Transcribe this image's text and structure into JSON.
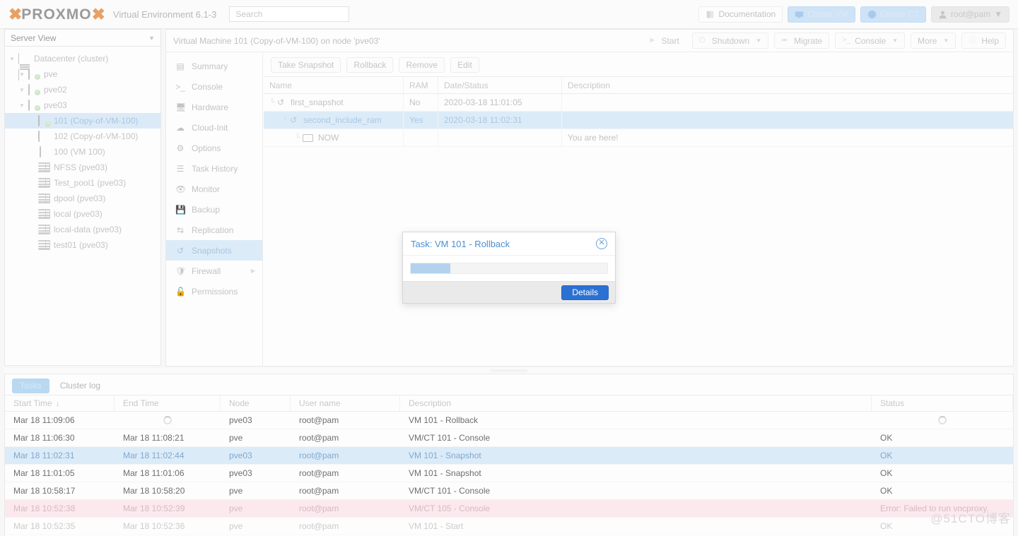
{
  "topbar": {
    "logo_text": "PROXMO",
    "env_label": "Virtual Environment 6.1-3",
    "search_placeholder": "Search",
    "buttons": [
      {
        "label": "Documentation",
        "icon": "book-icon"
      },
      {
        "label": "Create VM",
        "icon": "monitor-icon"
      },
      {
        "label": "Create CT",
        "icon": "container-icon"
      },
      {
        "label": "root@pam",
        "icon": "user-icon"
      }
    ]
  },
  "sidebar": {
    "view_label": "Server View",
    "items": [
      {
        "label": "Datacenter (cluster)",
        "icon": "datacenter-icon",
        "depth": 0,
        "selected": false
      },
      {
        "label": "pve",
        "icon": "node-icon",
        "depth": 1,
        "selected": false
      },
      {
        "label": "pve02",
        "icon": "node-icon",
        "depth": 1,
        "selected": false
      },
      {
        "label": "pve03",
        "icon": "node-icon",
        "depth": 1,
        "selected": false
      },
      {
        "label": "101 (Copy-of-VM-100)",
        "icon": "vm-running-icon",
        "depth": 2,
        "selected": true
      },
      {
        "label": "102 (Copy-of-VM-100)",
        "icon": "vm-stopped-icon",
        "depth": 2,
        "selected": false
      },
      {
        "label": "100 (VM 100)",
        "icon": "vm-template-icon",
        "depth": 2,
        "selected": false
      },
      {
        "label": "NFSS (pve03)",
        "icon": "storage-icon",
        "depth": 2,
        "selected": false
      },
      {
        "label": "Test_pool1 (pve03)",
        "icon": "storage-icon",
        "depth": 2,
        "selected": false
      },
      {
        "label": "dpool (pve03)",
        "icon": "storage-icon",
        "depth": 2,
        "selected": false
      },
      {
        "label": "local (pve03)",
        "icon": "storage-icon",
        "depth": 2,
        "selected": false
      },
      {
        "label": "local-data (pve03)",
        "icon": "storage-icon",
        "depth": 2,
        "selected": false
      },
      {
        "label": "test01 (pve03)",
        "icon": "storage-icon",
        "depth": 2,
        "selected": false
      }
    ]
  },
  "content_header": {
    "title": "Virtual Machine 101 (Copy-of-VM-100) on node 'pve03'",
    "buttons": [
      {
        "label": "Start",
        "icon": "play-icon",
        "has_arrow": false
      },
      {
        "label": "Shutdown",
        "icon": "power-icon",
        "has_arrow": true
      },
      {
        "label": "Migrate",
        "icon": "migrate-icon",
        "has_arrow": false
      },
      {
        "label": "Console",
        "icon": "terminal-icon",
        "has_arrow": true
      },
      {
        "label": "More",
        "icon": "",
        "has_arrow": true
      },
      {
        "label": "Help",
        "icon": "help-icon",
        "has_arrow": false
      }
    ]
  },
  "nav_menu": {
    "items": [
      {
        "label": "Summary",
        "icon": "summary-icon",
        "selected": false,
        "arrow": false
      },
      {
        "label": "Console",
        "icon": "terminal-icon",
        "selected": false,
        "arrow": false
      },
      {
        "label": "Hardware",
        "icon": "monitor-icon",
        "selected": false,
        "arrow": false
      },
      {
        "label": "Cloud-Init",
        "icon": "cloud-icon",
        "selected": false,
        "arrow": false
      },
      {
        "label": "Options",
        "icon": "gear-icon",
        "selected": false,
        "arrow": false
      },
      {
        "label": "Task History",
        "icon": "list-icon",
        "selected": false,
        "arrow": false
      },
      {
        "label": "Monitor",
        "icon": "eye-icon",
        "selected": false,
        "arrow": false
      },
      {
        "label": "Backup",
        "icon": "save-icon",
        "selected": false,
        "arrow": false
      },
      {
        "label": "Replication",
        "icon": "replication-icon",
        "selected": false,
        "arrow": false
      },
      {
        "label": "Snapshots",
        "icon": "rollback-icon",
        "selected": true,
        "arrow": false
      },
      {
        "label": "Firewall",
        "icon": "shield-icon",
        "selected": false,
        "arrow": true
      },
      {
        "label": "Permissions",
        "icon": "unlock-icon",
        "selected": false,
        "arrow": false
      }
    ]
  },
  "snapshots": {
    "toolbar": [
      {
        "label": "Take Snapshot"
      },
      {
        "label": "Rollback"
      },
      {
        "label": "Remove"
      },
      {
        "label": "Edit"
      }
    ],
    "columns": [
      "Name",
      "RAM",
      "Date/Status",
      "Description"
    ],
    "rows": [
      {
        "name": "first_snapshot",
        "icon": "rollback-icon",
        "depth": 0,
        "ram": "No",
        "date": "2020-03-18 11:01:05",
        "description": "",
        "selected": false
      },
      {
        "name": "second_include_ram",
        "icon": "rollback-icon",
        "depth": 1,
        "ram": "Yes",
        "date": "2020-03-18 11:02:31",
        "description": "",
        "selected": true
      },
      {
        "name": "NOW",
        "icon": "monitor-icon",
        "depth": 2,
        "ram": "",
        "date": "",
        "description": "You are here!",
        "selected": false
      }
    ]
  },
  "modal": {
    "title": "Task: VM 101 - Rollback",
    "close_icon": "close-icon",
    "progress_percent": 20,
    "details_label": "Details"
  },
  "bottom_panel": {
    "tabs": [
      {
        "label": "Tasks",
        "active": true
      },
      {
        "label": "Cluster log",
        "active": false
      }
    ],
    "columns": [
      "Start Time",
      "End Time",
      "Node",
      "User name",
      "Description",
      "Status"
    ],
    "sort_indicator": "↓",
    "rows": [
      {
        "start": "Mar 18 11:09:06",
        "end": "",
        "end_icon": "spinner-icon",
        "node": "pve03",
        "user": "root@pam",
        "description": "VM 101 - Rollback",
        "status": "",
        "status_icon": "spinner-icon",
        "state": "running"
      },
      {
        "start": "Mar 18 11:06:30",
        "end": "Mar 18 11:08:21",
        "end_icon": "",
        "node": "pve",
        "user": "root@pam",
        "description": "VM/CT 101 - Console",
        "status": "OK",
        "status_icon": "",
        "state": "ok"
      },
      {
        "start": "Mar 18 11:02:31",
        "end": "Mar 18 11:02:44",
        "end_icon": "",
        "node": "pve03",
        "user": "root@pam",
        "description": "VM 101 - Snapshot",
        "status": "OK",
        "status_icon": "",
        "state": "selected"
      },
      {
        "start": "Mar 18 11:01:05",
        "end": "Mar 18 11:01:06",
        "end_icon": "",
        "node": "pve03",
        "user": "root@pam",
        "description": "VM 101 - Snapshot",
        "status": "OK",
        "status_icon": "",
        "state": "ok"
      },
      {
        "start": "Mar 18 10:58:17",
        "end": "Mar 18 10:58:20",
        "end_icon": "",
        "node": "pve",
        "user": "root@pam",
        "description": "VM/CT 101 - Console",
        "status": "OK",
        "status_icon": "",
        "state": "ok"
      },
      {
        "start": "Mar 18 10:52:38",
        "end": "Mar 18 10:52:39",
        "end_icon": "",
        "node": "pve",
        "user": "root@pam",
        "description": "VM/CT 105 - Console",
        "status": "Error: Failed to run vncproxy.",
        "status_icon": "",
        "state": "error"
      },
      {
        "start": "Mar 18 10:52:35",
        "end": "Mar 18 10:52:36",
        "end_icon": "",
        "node": "pve",
        "user": "root@pam",
        "description": "VM 101 - Start",
        "status": "OK",
        "status_icon": "",
        "state": "cut"
      }
    ]
  },
  "watermark": "@51CTO博客",
  "colors": {
    "accent_blue": "#2b71d3",
    "selection_blue": "#dcebf8",
    "error_pink": "#fbe9ee",
    "logo_orange": "#e8a065",
    "title_blue": "#4d8fd1"
  }
}
